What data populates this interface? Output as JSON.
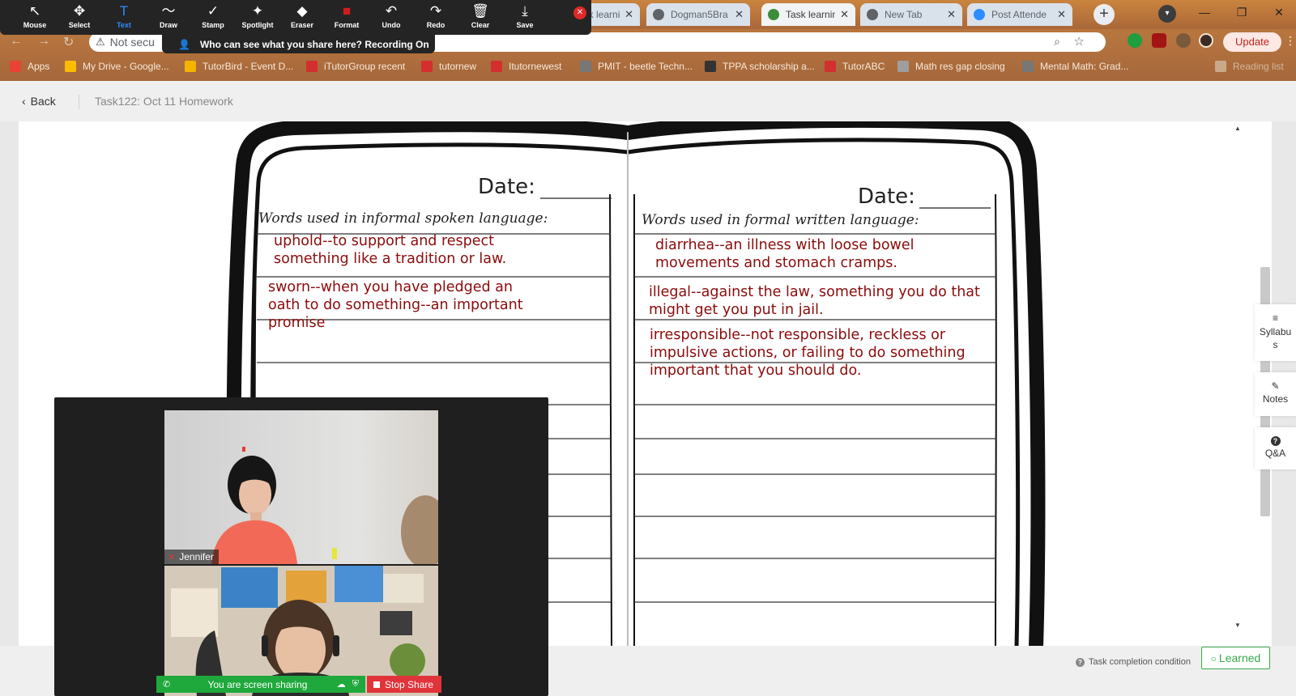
{
  "browser": {
    "tabs": [
      {
        "title": "Task learning",
        "active": false,
        "favicon_color": "#8ab4f8",
        "show_favicon": false
      },
      {
        "title": "Dogman5Bra",
        "active": false,
        "favicon_color": "#5f6368",
        "show_favicon": true
      },
      {
        "title": "Task learning",
        "active": true,
        "favicon_color": "#3c8d3c",
        "show_favicon": true
      },
      {
        "title": "New Tab",
        "active": false,
        "favicon_color": "#5f6368",
        "show_favicon": true
      },
      {
        "title": "Post Attende",
        "active": false,
        "favicon_color": "#2d8cff",
        "show_favicon": true
      }
    ],
    "new_tab_symbol": "+",
    "address": {
      "security_label": "Not secu",
      "warning_icon": "warning-triangle-icon"
    },
    "update_label": "Update",
    "bookmarks": [
      {
        "label": "Apps",
        "icon_color": "#ea4335",
        "faded": false
      },
      {
        "label": "My Drive - Google...",
        "icon_color": "#fbbc04",
        "faded": false
      },
      {
        "label": "TutorBird - Event D...",
        "icon_color": "#f4b400",
        "faded": false
      },
      {
        "label": "iTutorGroup recent",
        "icon_color": "#d32f2f",
        "faded": false
      },
      {
        "label": "tutornew",
        "icon_color": "#d32f2f",
        "faded": false
      },
      {
        "label": "Itutornewest",
        "icon_color": "#d32f2f",
        "faded": false
      },
      {
        "label": "PMIT - beetle Techn...",
        "icon_color": "#777777",
        "faded": false
      },
      {
        "label": "TPPA scholarship a...",
        "icon_color": "#333333",
        "faded": false
      },
      {
        "label": "TutorABC",
        "icon_color": "#d32f2f",
        "faded": false
      },
      {
        "label": "Math res gap closing",
        "icon_color": "#9e9e9e",
        "faded": false
      },
      {
        "label": "Mental Math: Grad...",
        "icon_color": "#777777",
        "faded": false
      },
      {
        "label": "Reading list",
        "icon_color": "#c9a98a",
        "faded": true
      }
    ]
  },
  "zoom_toolbar": {
    "tools": [
      {
        "label": "Mouse",
        "icon": "↖",
        "selected": false
      },
      {
        "label": "Select",
        "icon": "✥",
        "selected": false
      },
      {
        "label": "Text",
        "icon": "T",
        "selected": true
      },
      {
        "label": "Draw",
        "icon": "〜",
        "selected": false
      },
      {
        "label": "Stamp",
        "icon": "✓",
        "selected": false
      },
      {
        "label": "Spotlight",
        "icon": "✦",
        "selected": false
      },
      {
        "label": "Eraser",
        "icon": "◆",
        "selected": false
      },
      {
        "label": "Format",
        "icon": "■",
        "selected": false
      },
      {
        "label": "Undo",
        "icon": "↶",
        "selected": false
      },
      {
        "label": "Redo",
        "icon": "↷",
        "selected": false
      },
      {
        "label": "Clear",
        "icon": "🗑",
        "selected": false
      },
      {
        "label": "Save",
        "icon": "⤓",
        "selected": false
      }
    ],
    "format_color": "#d01c1c",
    "close_symbol": "✕",
    "recording_banner": "Who can see what you share here? Recording On"
  },
  "page": {
    "back_label": "Back",
    "title": "Task122:  Oct 11 Homework"
  },
  "worksheet": {
    "left": {
      "date_label": "Date:",
      "heading": "Words used in informal spoken language:",
      "entries": [
        "uphold--to support and respect\nsomething like a tradition or law.",
        "sworn--when you have pledged an\noath to do something--an important\npromise"
      ]
    },
    "right": {
      "date_label": "Date:",
      "heading": "Words used in formal written language:",
      "entries": [
        "diarrhea--an illness with loose bowel\nmovements and stomach cramps.",
        "illegal--against the law, something you do that\nmight get you put in jail.",
        "irresponsible--not responsible, reckless or\nimpulsive actions, or failing to do something\nimportant that you should do."
      ]
    }
  },
  "side_panel": [
    {
      "label": "Syllabus",
      "icon": "syllabus-icon",
      "glyph": "≡"
    },
    {
      "label": "Notes",
      "icon": "pencil-icon",
      "glyph": "✎"
    },
    {
      "label": "Q&A",
      "icon": "question-icon",
      "glyph": "?"
    }
  ],
  "footer": {
    "completion_label": "Task completion condition",
    "learned_label": "Learned"
  },
  "video": {
    "participants": [
      {
        "name": "Jennifer",
        "muted": true
      },
      {
        "name": "",
        "muted": false
      }
    ],
    "sharing_label": "You are screen sharing",
    "stop_share_label": "Stop Share"
  }
}
